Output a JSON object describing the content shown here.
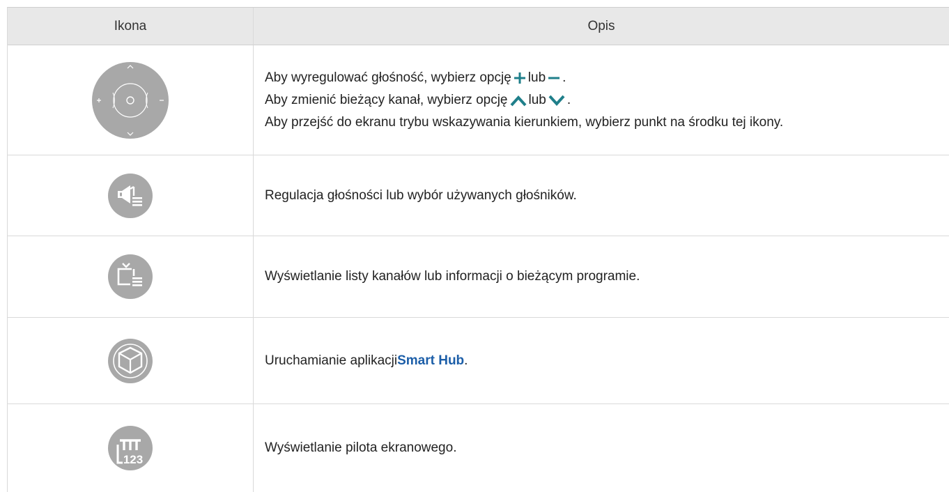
{
  "header": {
    "icon_col": "Ikona",
    "desc_col": "Opis"
  },
  "accent_color": "#1f7f8a",
  "icon_color": "#a8a8a8",
  "rows": [
    {
      "icon": "volume-channel-dial-icon",
      "lines": [
        {
          "pre": "Aby wyregulować głośność, wybierz opcję ",
          "mid": " lub ",
          "post": "."
        },
        {
          "pre": "Aby zmienić bieżący kanał, wybierz opcję ",
          "mid": " lub ",
          "post": "."
        },
        {
          "text": "Aby przejść do ekranu trybu wskazywania kierunkiem, wybierz punkt na środku tej ikony."
        }
      ]
    },
    {
      "icon": "speaker-settings-icon",
      "text": "Regulacja głośności lub wybór używanych głośników."
    },
    {
      "icon": "tv-channel-list-icon",
      "text": "Wyświetlanie listy kanałów lub informacji o bieżącym programie."
    },
    {
      "icon": "smart-hub-icon",
      "pre": "Uruchamianie aplikacji ",
      "highlight": "Smart Hub",
      "post": "."
    },
    {
      "icon": "virtual-remote-icon",
      "text": "Wyświetlanie pilota ekranowego.",
      "icon_text": "123"
    }
  ]
}
